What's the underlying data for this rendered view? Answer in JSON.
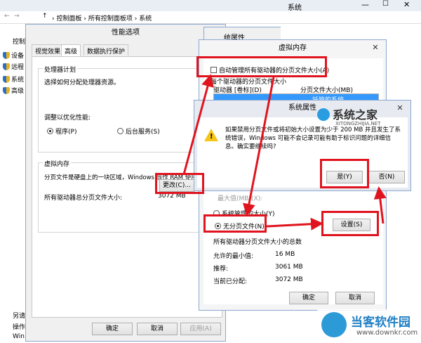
{
  "explorer": {
    "title": "系统",
    "breadcrumb": [
      "控制面板",
      "所有控制面板项",
      "系统"
    ],
    "sidebar_header": "控制",
    "sidebar_items": [
      "设备",
      "远程",
      "系统",
      "高级"
    ],
    "footer_items": [
      "另请",
      "操作",
      "Win"
    ]
  },
  "perf": {
    "title": "性能选项",
    "tabs": [
      "视觉效果",
      "高级",
      "数据执行保护"
    ],
    "scheduling_group": "处理器计划",
    "scheduling_desc": "选择如何分配处理器资源。",
    "adjust_label": "调整以优化性能:",
    "radio_programs": "程序(P)",
    "radio_background": "后台服务(S)",
    "vm_group": "虚拟内存",
    "vm_desc": "分页文件是硬盘上的一块区域，Windows 当作 RAM 使用。",
    "total_label": "所有驱动器总分页文件大小:",
    "total_value": "3072 MB",
    "change_button": "更改(C)...",
    "ok": "确定",
    "cancel": "取消",
    "apply": "应用(A)"
  },
  "sysprop": {
    "title": "统属性"
  },
  "vmem": {
    "title": "虚拟内存",
    "auto_manage": "自动管理所有驱动器的分页文件大小(A)",
    "per_drive": "每个驱动器的分页文件大小",
    "col_drive": "驱动器 [卷标](D)",
    "col_size": "分页文件大小(MB)",
    "row_partial": "托管的系统",
    "max_size": "最大值(MB)(X):",
    "system_managed": "系统管理的大小(Y)",
    "no_paging": "无分页文件(N)",
    "set_button": "设置(S)",
    "total_group": "所有驱动器分页文件大小的总数",
    "min_label": "允许的最小值:",
    "min_value": "16 MB",
    "rec_label": "推荐:",
    "rec_value": "3061 MB",
    "cur_label": "当前已分配:",
    "cur_value": "3072 MB",
    "ok": "确定",
    "cancel": "取消"
  },
  "alert": {
    "title": "系统属性",
    "message": "如果禁用分页文件或将初始大小设置为少于 200 MB 并且发生了系统错误，Windows 可能不会记录可能有助于标识问题的详细信息。确实要继续吗?",
    "yes": "是(Y)",
    "no": "否(N)"
  },
  "watermarks": {
    "site1": "系统之家",
    "site1_url": "XITONGZHIJIA.NET",
    "site2": "当客软件园",
    "site2_url": "www.downkr.com"
  }
}
